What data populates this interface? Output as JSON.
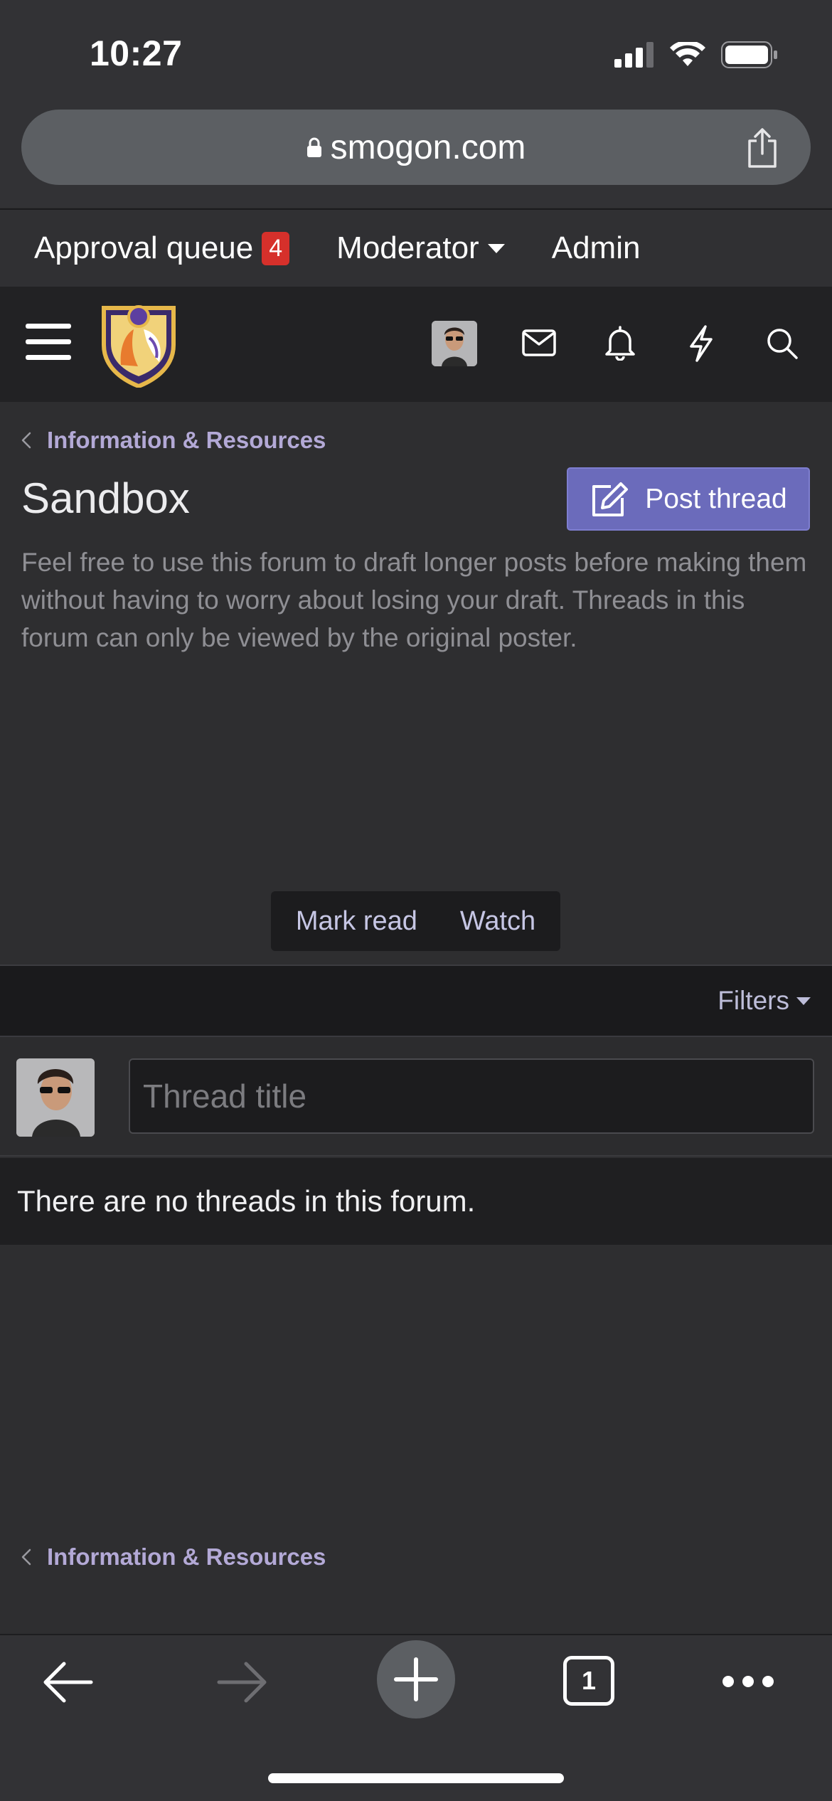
{
  "status_bar": {
    "time": "10:27",
    "icons": [
      "signal-icon",
      "wifi-icon",
      "battery-icon"
    ]
  },
  "url_bar": {
    "domain": "smogon.com",
    "icons": [
      "lock-icon",
      "share-icon"
    ]
  },
  "staff_bar": {
    "approval_label": "Approval queue",
    "approval_count": "4",
    "moderator_label": "Moderator",
    "admin_label": "Admin"
  },
  "navbar": {
    "icons": [
      "menu-icon",
      "site-logo",
      "avatar",
      "mail-icon",
      "bell-icon",
      "lightning-icon",
      "search-icon"
    ]
  },
  "breadcrumb": {
    "label": "Information & Resources"
  },
  "forum": {
    "title": "Sandbox",
    "post_button_label": "Post thread",
    "description": "Feel free to use this forum to draft longer posts before making them without having to worry about losing your draft. Threads in this forum can only be viewed by the original poster."
  },
  "actions": {
    "mark_read": "Mark read",
    "watch": "Watch"
  },
  "filters": {
    "label": "Filters"
  },
  "quick_thread": {
    "placeholder": "Thread title"
  },
  "empty_message": "There are no threads in this forum.",
  "bottom_breadcrumb": {
    "label": "Information & Resources"
  },
  "browser_toolbar": {
    "tab_count": "1",
    "icons": [
      "back-arrow-icon",
      "forward-arrow-icon",
      "new-tab-icon",
      "tabs-icon",
      "more-icon"
    ]
  },
  "colors": {
    "accent": "#6b6bbb",
    "link": "#b3a9d6",
    "badge": "#d6302b",
    "background": "#2e2e30"
  }
}
